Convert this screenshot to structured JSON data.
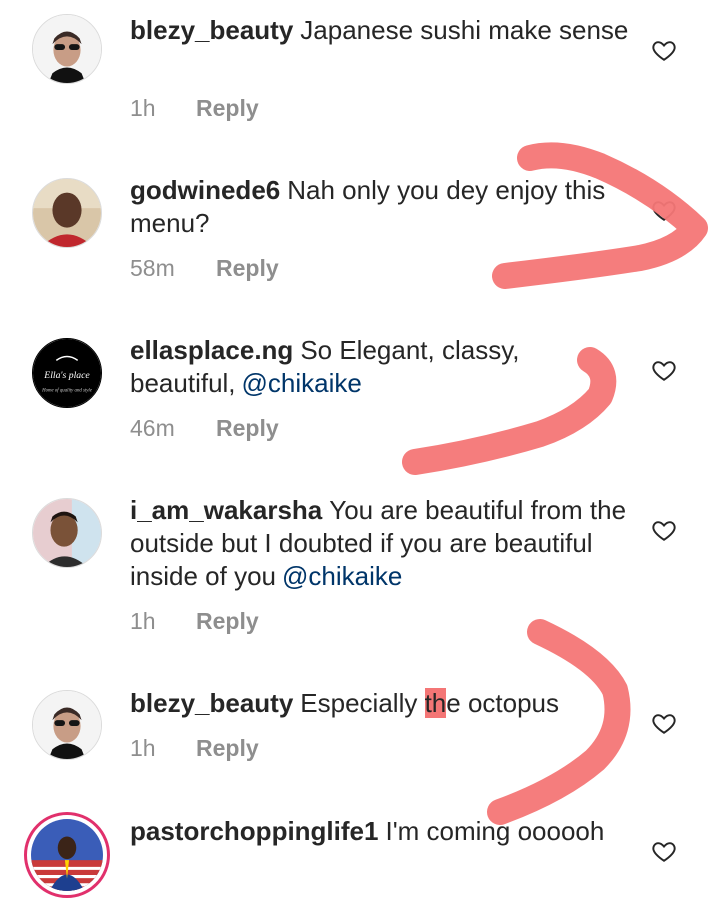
{
  "comments": [
    {
      "username": "blezy_beauty",
      "text": "Japanese sushi make sense",
      "time": "1h",
      "reply": "Reply"
    },
    {
      "username": "godwinede6",
      "text": "Nah only you dey enjoy this menu?",
      "time": "58m",
      "reply": "Reply"
    },
    {
      "username": "ellasplace.ng",
      "text": "So Elegant, classy, beautiful,",
      "mention": "@chikaike",
      "time": "46m",
      "reply": "Reply",
      "avatar_text": "Ella's place",
      "avatar_subtext": "Home of quality and style"
    },
    {
      "username": "i_am_wakarsha",
      "text": "You are beautiful  from the outside but I doubted if you are beautiful  inside of you",
      "mention": "@chikaike",
      "time": "1h",
      "reply": "Reply"
    },
    {
      "username": "blezy_beauty",
      "text_before": "Especially ",
      "text_highlight": "th",
      "text_after": "e octopus",
      "time": "1h",
      "reply": "Reply"
    },
    {
      "username": "pastorchoppinglife1",
      "text": "I'm coming oooooh"
    }
  ],
  "icons": {
    "like": "heart-outline-icon"
  },
  "colors": {
    "username": "#262626",
    "meta": "#8e8e8e",
    "mention": "#003569",
    "annotation": "#f47676"
  }
}
